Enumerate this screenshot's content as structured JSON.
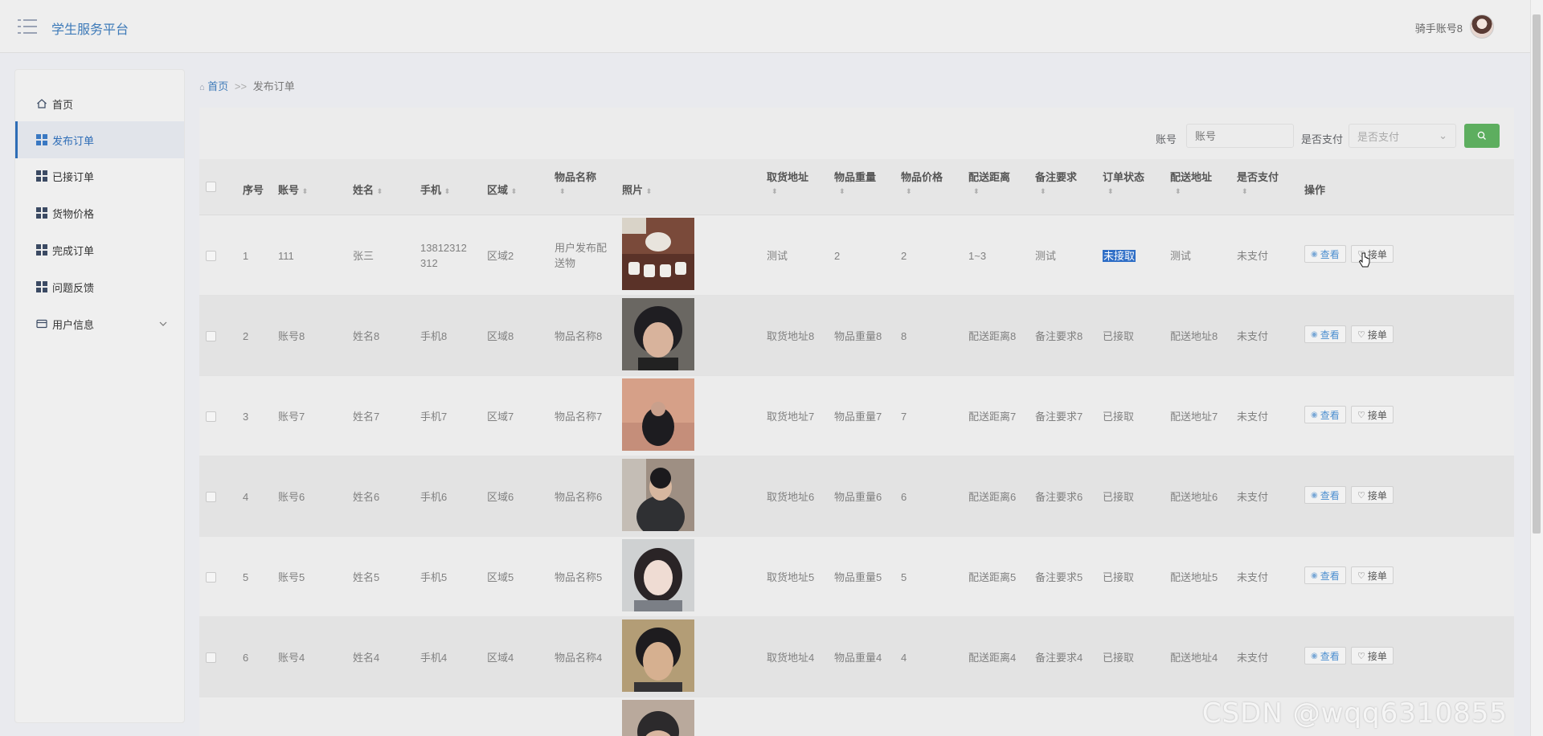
{
  "header": {
    "title": "学生服务平台",
    "user": "骑手账号8"
  },
  "sidebar": {
    "items": [
      {
        "label": "首页",
        "icon": "home-icon"
      },
      {
        "label": "发布订单",
        "icon": "grid-icon",
        "active": true
      },
      {
        "label": "已接订单",
        "icon": "grid-icon"
      },
      {
        "label": "货物价格",
        "icon": "grid-icon"
      },
      {
        "label": "完成订单",
        "icon": "grid-icon"
      },
      {
        "label": "问题反馈",
        "icon": "grid-icon"
      },
      {
        "label": "用户信息",
        "icon": "card-icon",
        "has_submenu": true
      }
    ]
  },
  "breadcrumb": {
    "home": "首页",
    "separator": ">>",
    "current": "发布订单"
  },
  "search": {
    "account_label": "账号",
    "account_placeholder": "账号",
    "paid_label": "是否支付",
    "paid_placeholder": "是否支付"
  },
  "table": {
    "columns": [
      "序号",
      "账号",
      "姓名",
      "手机",
      "区域",
      "物品名称",
      "照片",
      "取货地址",
      "物品重量",
      "物品价格",
      "配送距离",
      "备注要求",
      "订单状态",
      "配送地址",
      "是否支付",
      "操作"
    ],
    "actions": {
      "view": "查看",
      "take": "接单"
    },
    "rows": [
      {
        "index": "1",
        "account": "111",
        "name": "张三",
        "phone": "13812312312",
        "region": "区域2",
        "item": "用户发布配送物",
        "pickup": "测试",
        "weight": "2",
        "price": "2",
        "distance": "1~3",
        "remark": "测试",
        "status": "未接取",
        "address": "测试",
        "paid": "未支付"
      },
      {
        "index": "2",
        "account": "账号8",
        "name": "姓名8",
        "phone": "手机8",
        "region": "区域8",
        "item": "物品名称8",
        "pickup": "取货地址8",
        "weight": "物品重量8",
        "price": "8",
        "distance": "配送距离8",
        "remark": "备注要求8",
        "status": "已接取",
        "address": "配送地址8",
        "paid": "未支付"
      },
      {
        "index": "3",
        "account": "账号7",
        "name": "姓名7",
        "phone": "手机7",
        "region": "区域7",
        "item": "物品名称7",
        "pickup": "取货地址7",
        "weight": "物品重量7",
        "price": "7",
        "distance": "配送距离7",
        "remark": "备注要求7",
        "status": "已接取",
        "address": "配送地址7",
        "paid": "未支付"
      },
      {
        "index": "4",
        "account": "账号6",
        "name": "姓名6",
        "phone": "手机6",
        "region": "区域6",
        "item": "物品名称6",
        "pickup": "取货地址6",
        "weight": "物品重量6",
        "price": "6",
        "distance": "配送距离6",
        "remark": "备注要求6",
        "status": "已接取",
        "address": "配送地址6",
        "paid": "未支付"
      },
      {
        "index": "5",
        "account": "账号5",
        "name": "姓名5",
        "phone": "手机5",
        "region": "区域5",
        "item": "物品名称5",
        "pickup": "取货地址5",
        "weight": "物品重量5",
        "price": "5",
        "distance": "配送距离5",
        "remark": "备注要求5",
        "status": "已接取",
        "address": "配送地址5",
        "paid": "未支付"
      },
      {
        "index": "6",
        "account": "账号4",
        "name": "姓名4",
        "phone": "手机4",
        "region": "区域4",
        "item": "物品名称4",
        "pickup": "取货地址4",
        "weight": "物品重量4",
        "price": "4",
        "distance": "配送距离4",
        "remark": "备注要求4",
        "status": "已接取",
        "address": "配送地址4",
        "paid": "未支付"
      }
    ]
  },
  "watermark": "CSDN @wqq6310855"
}
